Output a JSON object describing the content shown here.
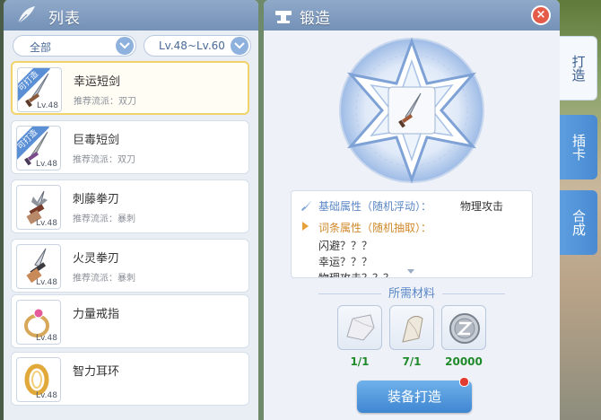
{
  "list_panel": {
    "title": "列表",
    "filter_type": "全部",
    "filter_level": "Lv.48~Lv.60",
    "items": [
      {
        "name": "幸运短剑",
        "sub": "推荐流派：双刀",
        "level": "Lv.48",
        "badge": "可打造",
        "selected": true,
        "icon": "dagger-icon"
      },
      {
        "name": "巨毒短剑",
        "sub": "推荐流派：双刀",
        "level": "Lv.48",
        "badge": "可打造",
        "selected": false,
        "icon": "poison-dagger-icon"
      },
      {
        "name": "刺藤拳刃",
        "sub": "推荐流派：暴刺",
        "level": "Lv.48",
        "badge": "",
        "selected": false,
        "icon": "katar-icon"
      },
      {
        "name": "火灵拳刃",
        "sub": "推荐流派：暴刺",
        "level": "Lv.48",
        "badge": "",
        "selected": false,
        "icon": "fire-katar-icon"
      },
      {
        "name": "力量戒指",
        "sub": "",
        "level": "Lv.48",
        "badge": "",
        "selected": false,
        "icon": "ring-icon"
      },
      {
        "name": "智力耳环",
        "sub": "",
        "level": "Lv.48",
        "badge": "",
        "selected": false,
        "icon": "earring-icon"
      }
    ]
  },
  "forge": {
    "title": "锻造",
    "close": "×",
    "base_attr_label": "基础属性（随机浮动）：",
    "base_attr_value": "物理攻击",
    "word_attr_label": "词条属性（随机抽取）：",
    "word_attrs": [
      "闪避？？？",
      "幸运？？？",
      "物理攻击？？？"
    ],
    "materials_title": "所需材料",
    "materials": [
      {
        "icon": "ore-icon",
        "count": "1/1",
        "color": "#1f8a2a"
      },
      {
        "icon": "crystal-icon",
        "count": "7/1",
        "color": "#1f8a2a"
      },
      {
        "icon": "zeny-coin-icon",
        "count": "20000",
        "color": "#1f8a2a"
      }
    ],
    "craft_button": "装备打造"
  },
  "tabs": [
    {
      "label": "打造",
      "active": true
    },
    {
      "label": "插卡",
      "active": false
    },
    {
      "label": "合成",
      "active": false
    }
  ]
}
